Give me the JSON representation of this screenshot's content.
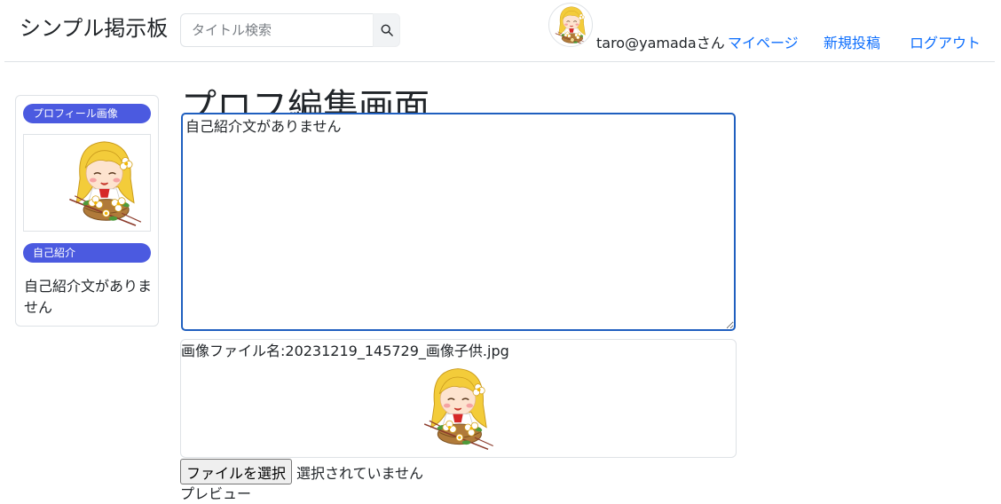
{
  "header": {
    "brand": "シンプル掲示板",
    "search_placeholder": "タイトル検索",
    "user_text": "taro@yamadaさん",
    "nav": {
      "mypage": "マイページ",
      "new_post": "新規投稿",
      "logout": "ログアウト"
    }
  },
  "sidebar": {
    "profile_image_label": "プロフィール画像",
    "intro_label": "自己紹介",
    "intro_text": "自己紹介文がありません"
  },
  "main": {
    "title": "プロフ編集画面",
    "intro_value": "自己紹介文がありません",
    "image_file_label": "画像ファイル名:20231219_145729_画像子供.jpg",
    "file_button": "ファイルを選択",
    "file_status": "選択されていません",
    "preview_label": "プレビュー"
  },
  "colors": {
    "link": "#0d6efd",
    "pill": "#4b5ae0",
    "focus_border": "#1f5fbf"
  }
}
